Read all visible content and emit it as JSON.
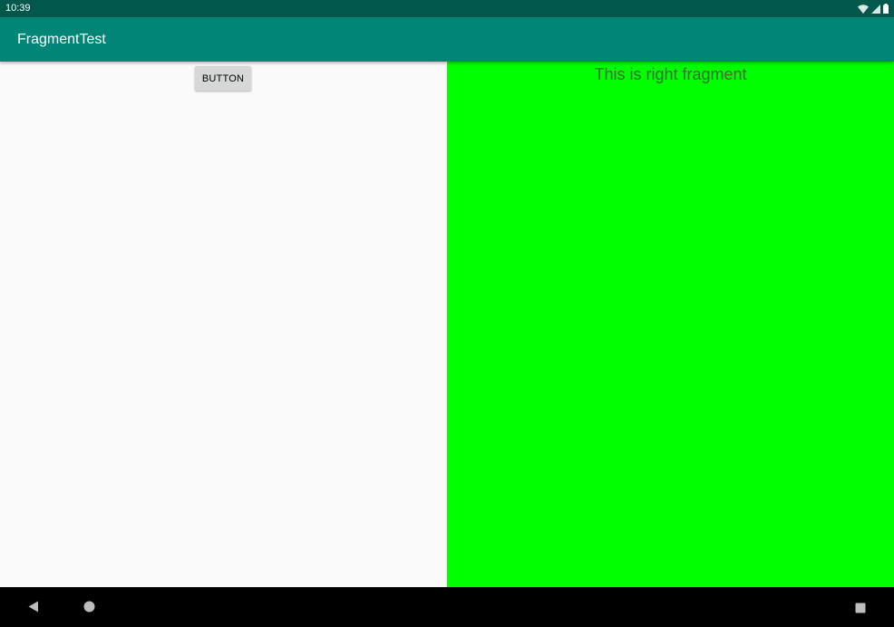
{
  "status_bar": {
    "time": "10:39",
    "icons": [
      "wifi-icon",
      "signal-icon",
      "battery-icon"
    ]
  },
  "app_bar": {
    "title": "FragmentTest",
    "color": "#008577"
  },
  "left_fragment": {
    "button_label": "BUTTON"
  },
  "right_fragment": {
    "text": "This is right fragment",
    "background": "#00ff00"
  },
  "nav_bar": {
    "icons": [
      "back-icon",
      "home-icon",
      "recents-icon"
    ]
  }
}
